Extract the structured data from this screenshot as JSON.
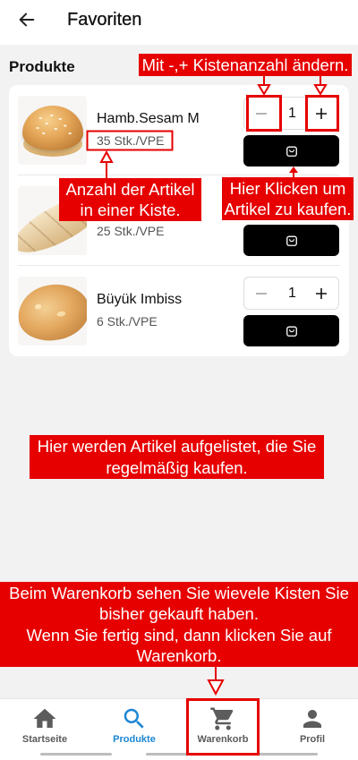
{
  "header": {
    "title": "Favoriten",
    "back_icon": "arrow-left-icon"
  },
  "section": {
    "title": "Produkte"
  },
  "product_actions": {
    "decrease_icon": "minus-icon",
    "increase_icon": "plus-icon",
    "buy_icon": "shopping-bag-icon"
  },
  "products": [
    {
      "name": "Hamb.Sesam M",
      "pack_size": "35 Stk./VPE",
      "quantity": "1"
    },
    {
      "pack_size": "25 Stk./VPE"
    },
    {
      "name": "Büyük Imbiss",
      "pack_size": "6 Stk./VPE",
      "quantity": "1"
    }
  ],
  "bottom_nav": {
    "items": [
      {
        "label": "Startseite",
        "icon": "home-icon",
        "active": false
      },
      {
        "label": "Produkte",
        "icon": "search-icon",
        "active": true
      },
      {
        "label": "Warenkorb",
        "icon": "cart-icon",
        "active": false
      },
      {
        "label": "Profil",
        "icon": "person-icon",
        "active": false
      }
    ]
  },
  "annotations": {
    "quantity_hint": {
      "lines": [
        "Mit -,+ Kistenanzahl ändern."
      ]
    },
    "pack_size_hint": {
      "lines": [
        "Anzahl der Artikel",
        "in einer Kiste."
      ]
    },
    "buy_hint": {
      "lines": [
        "Hier Klicken um",
        "Artikel zu kaufen."
      ]
    },
    "list_hint": {
      "lines": [
        "Hier werden Artikel aufgelistet, die Sie",
        "regelmäßig kaufen."
      ]
    },
    "cart_hint": {
      "lines": [
        "Beim Warenkorb sehen Sie wievele Kisten Sie",
        "bisher gekauft haben.",
        "Wenn Sie fertig sind, dann klicken Sie auf",
        "Warenkorb."
      ]
    }
  },
  "colors": {
    "accent": "#1d86d3",
    "annotation": "#e60000",
    "buy_button": "#000000",
    "page_background": "#f2f2f2"
  }
}
